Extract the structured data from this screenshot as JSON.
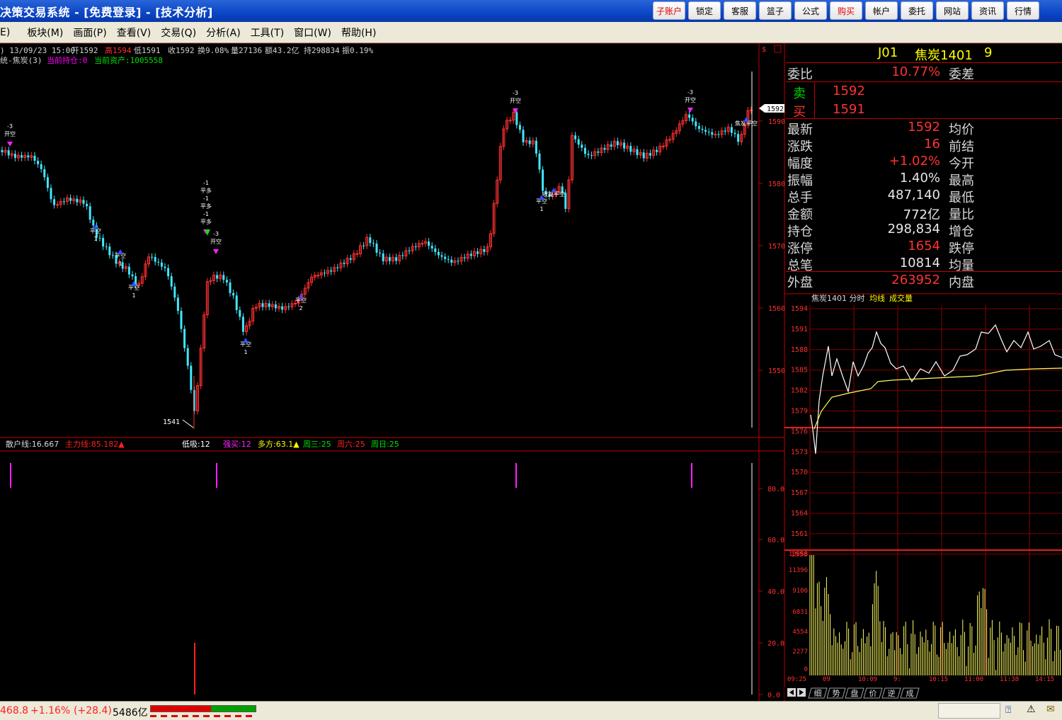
{
  "app": {
    "title": "决策交易系统 - [免费登录] - [技术分析]"
  },
  "topbar": {
    "buttons": [
      "子账户",
      "锁定",
      "客服",
      "篮子",
      "公式",
      "购买",
      "帐户",
      "委托",
      "网站",
      "资讯",
      "行情"
    ]
  },
  "menubar": {
    "items": [
      "E)",
      "板块(M)",
      "画面(P)",
      "查看(V)",
      "交易(Q)",
      "分析(A)",
      "工具(T)",
      "窗口(W)",
      "帮助(H)"
    ]
  },
  "chart": {
    "header_line1": {
      "date": ") 13/09/23 15:00",
      "open": "开1592",
      "high": "高1594",
      "low": "低1591",
      "close": "收1592",
      "turnover": "换9.08%",
      "volume": "量27136",
      "amount": "额43.2亿",
      "hold": "持298834",
      "amp": "振0.19%"
    },
    "header_line2": {
      "system": "统-焦炭(3)",
      "position": "当前持仓:0",
      "assets": "当前资产:1005558"
    },
    "price_axis": [
      "1590",
      "1580",
      "1570",
      "1560",
      "1550"
    ],
    "last_price_tag": "1592",
    "low_label": "1541",
    "signals": [
      {
        "id": "s1",
        "lines": [
          "-3",
          "开空"
        ]
      },
      {
        "id": "s2",
        "lines": [
          "平空",
          "1"
        ]
      },
      {
        "id": "s3",
        "lines": [
          "平空",
          "1"
        ]
      },
      {
        "id": "s4",
        "lines": [
          "平空",
          "1"
        ]
      },
      {
        "id": "s5",
        "lines": [
          "-1",
          "平多",
          "-1",
          "平多",
          "-1",
          "平多"
        ]
      },
      {
        "id": "s6",
        "lines": [
          "-3",
          "开空"
        ]
      },
      {
        "id": "s7",
        "lines": [
          "平空",
          "1"
        ]
      },
      {
        "id": "s8",
        "lines": [
          "平空",
          "2"
        ]
      },
      {
        "id": "s9",
        "lines": [
          "-3",
          "开空"
        ]
      },
      {
        "id": "s10",
        "lines": [
          "平空",
          "1"
        ]
      },
      {
        "id": "s11",
        "lines": [
          "收复平空"
        ]
      },
      {
        "id": "s12",
        "lines": [
          "-3",
          "开空"
        ]
      },
      {
        "id": "s13",
        "lines": [
          "焦炭平空"
        ]
      }
    ]
  },
  "indicator": {
    "retail": "散户线:16.667",
    "main": "主力线:85.182▲",
    "dixi": "低吸:12",
    "qiangmai": "强买:12",
    "duofang": "多方:63.1▲",
    "zhousan": "周三:25",
    "zhouliu": "周六:25",
    "zhouri": "周日:25",
    "axis": [
      "80.0",
      "60.0",
      "40.0",
      "20.0",
      "0.0"
    ]
  },
  "quote": {
    "code": "J01",
    "name": "焦炭1401",
    "extra": "9",
    "weibi_label": "委比",
    "weibi": "10.77%",
    "weicha_label": "委差",
    "sell_label": "卖",
    "sell": "1592",
    "buy_label": "买",
    "buy": "1591",
    "rows": [
      {
        "l": "最新",
        "v": "1592",
        "c": "red",
        "r": "均价"
      },
      {
        "l": "涨跌",
        "v": "16",
        "c": "red",
        "r": "前结"
      },
      {
        "l": "幅度",
        "v": "+1.02%",
        "c": "red",
        "r": "今开"
      },
      {
        "l": "振幅",
        "v": "1.40%",
        "c": "white",
        "r": "最高"
      },
      {
        "l": "总手",
        "v": "487,140",
        "c": "white",
        "r": "最低"
      },
      {
        "l": "金额",
        "v": "772亿",
        "c": "white",
        "r": "量比"
      },
      {
        "l": "持仓",
        "v": "298,834",
        "c": "white",
        "r": "增仓"
      },
      {
        "l": "涨停",
        "v": "1654",
        "c": "red",
        "r": "跌停"
      },
      {
        "l": "总笔",
        "v": "10814",
        "c": "white",
        "r": "均量"
      },
      {
        "l": "外盘",
        "v": "263952",
        "c": "red",
        "r": "内盘"
      }
    ]
  },
  "minute": {
    "title": "焦炭1401 分时",
    "avg_label": "均线",
    "vol_label": "成交量",
    "price_axis": [
      "1594",
      "1591",
      "1588",
      "1585",
      "1582",
      "1579",
      "1576",
      "1573",
      "1570",
      "1567",
      "1564",
      "1561",
      "1558"
    ],
    "vol_axis": [
      "13888",
      "11396",
      "9106",
      "6831",
      "4554",
      "2277",
      "0"
    ],
    "time_labels": [
      "09:25",
      "09",
      "10:09",
      "9:",
      "10:15",
      "11:00",
      "11:38",
      "14:15"
    ],
    "tabs": [
      "细",
      "势",
      "盘",
      "价",
      "逆",
      "成"
    ]
  },
  "status": {
    "index": "468.8",
    "change": "+1.16%",
    "points": "(+28.4)",
    "amount": "5486亿"
  }
}
